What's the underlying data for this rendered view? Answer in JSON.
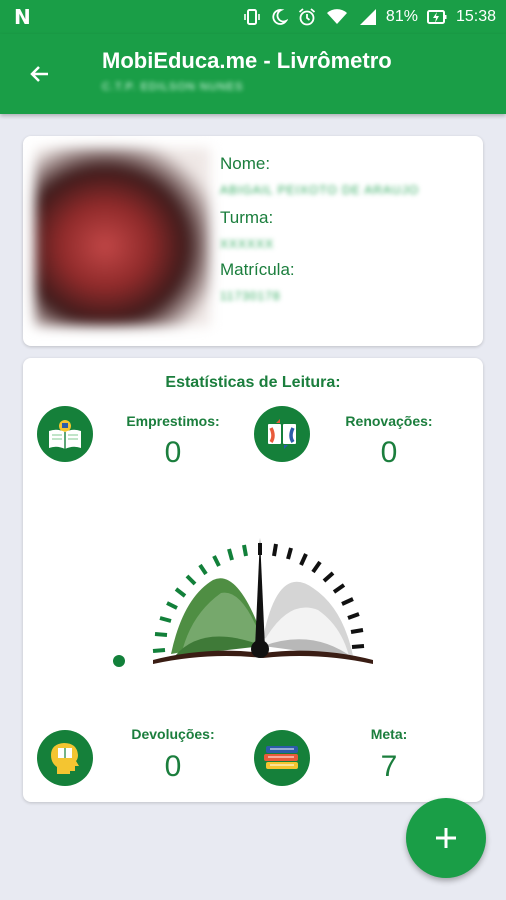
{
  "status_bar": {
    "notification_icon": "N",
    "battery": "81%",
    "time": "15:38"
  },
  "app_bar": {
    "title": "MobiEduca.me - Livrômetro",
    "subtitle": "C.T.P. EDILSON NUNES"
  },
  "profile": {
    "name_label": "Nome:",
    "name_value": "ABIGAIL PEIXOTO DE ARAUJO",
    "class_label": "Turma:",
    "class_value": "XXXXXX",
    "registration_label": "Matrícula:",
    "registration_value": "11730178"
  },
  "stats": {
    "title": "Estatísticas de Leitura:",
    "loans_label": "Emprestimos:",
    "loans_value": "0",
    "renewals_label": "Renovações:",
    "renewals_value": "0",
    "returns_label": "Devoluções:",
    "returns_value": "0",
    "goal_label": "Meta:",
    "goal_value": "7"
  },
  "colors": {
    "primary": "#1a9e47",
    "text_green": "#1b7e3d",
    "background": "#e8eaf2"
  }
}
